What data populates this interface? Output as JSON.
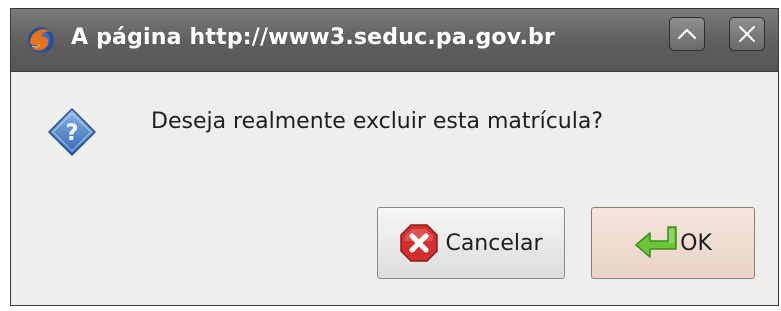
{
  "window": {
    "title": "A página http://www3.seduc.pa.gov.br",
    "app_icon": "firefox-icon",
    "controls": {
      "maximize_icon": "chevron-up-icon",
      "close_icon": "close-icon"
    }
  },
  "dialog": {
    "message": "Deseja realmente excluir esta matrícula?",
    "message_icon": "question-icon",
    "buttons": {
      "cancel_label": "Cancelar",
      "cancel_icon": "cancel-icon",
      "ok_label": "OK",
      "ok_icon": "enter-arrow-icon"
    }
  },
  "colors": {
    "titlebar": "#5e5e5e",
    "title_text": "#ffffff",
    "dialog_background": "#eeeeec",
    "cancel_icon": "#d32f2f",
    "ok_icon": "#4caf2a",
    "question_icon": "#4a7fc3"
  }
}
